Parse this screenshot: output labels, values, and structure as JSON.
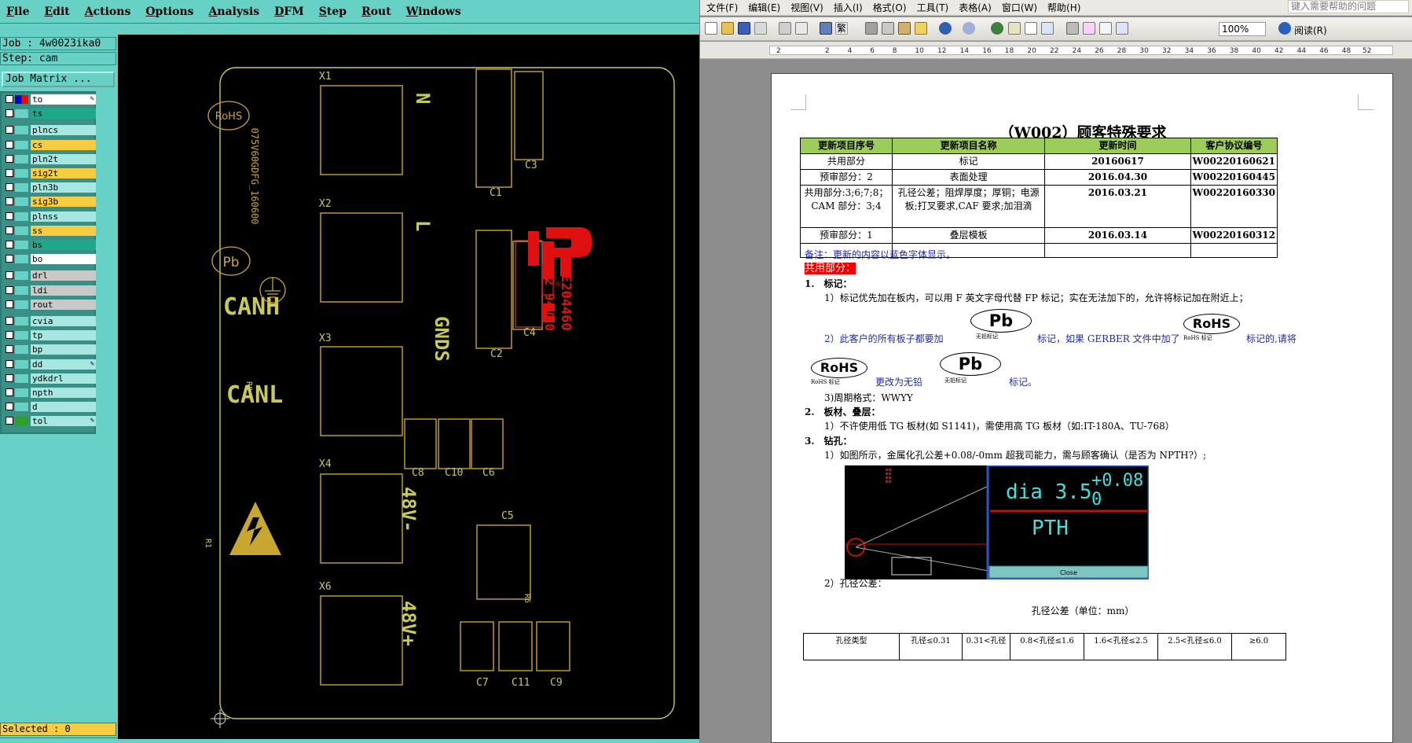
{
  "cam": {
    "menu": [
      "File",
      "Edit",
      "Actions",
      "Options",
      "Analysis",
      "DFM",
      "Step",
      "Rout",
      "Windows"
    ],
    "job_label": "Job : 4w0023ika0",
    "step_label": "Step: cam",
    "job_matrix_button": "Job Matrix ...",
    "layers": [
      {
        "name": "to",
        "style": "white",
        "swatch": "#0000cc",
        "swatch2": "#ff0000",
        "icon": "pencil"
      },
      {
        "name": "ts",
        "style": "green"
      },
      {
        "name": "plncs",
        "style": "cyan"
      },
      {
        "name": "cs",
        "style": "yellow"
      },
      {
        "name": "pln2t",
        "style": "cyan"
      },
      {
        "name": "sig2t",
        "style": "yellow"
      },
      {
        "name": "pln3b",
        "style": "cyan"
      },
      {
        "name": "sig3b",
        "style": "yellow"
      },
      {
        "name": "plnss",
        "style": "cyan"
      },
      {
        "name": "ss",
        "style": "yellow"
      },
      {
        "name": "bs",
        "style": "green"
      },
      {
        "name": "bo",
        "style": "white"
      },
      {
        "name": "drl",
        "style": "gray"
      },
      {
        "name": "ldi",
        "style": "gray"
      },
      {
        "name": "rout",
        "style": "gray"
      },
      {
        "name": "cvia",
        "style": "cyan"
      },
      {
        "name": "tp",
        "style": "cyan"
      },
      {
        "name": "bp",
        "style": "cyan"
      },
      {
        "name": "dd",
        "style": "cyan",
        "icon": "pencil"
      },
      {
        "name": "ydkdrl",
        "style": "cyan"
      },
      {
        "name": "npth",
        "style": "cyan"
      },
      {
        "name": "d",
        "style": "cyan"
      },
      {
        "name": "tol",
        "style": "cyan",
        "swatch": "#2ea02e",
        "icon": "pencil"
      }
    ],
    "selected_label": "Selected : 0",
    "board": {
      "silkscreen": {
        "rohs": "RoHS",
        "pb": "Pb",
        "date_code": "075V60GDFG_160600",
        "n": "N",
        "l": "L",
        "canh": "CANH",
        "canl": "CANL",
        "gnds": "GNDS",
        "v48n": "48V-",
        "v48p": "48V+",
        "ul_line1": "E204460",
        "ul_line2": "M2 94V-0",
        "refs": [
          "X1",
          "X2",
          "X3",
          "X4",
          "X6",
          "C1",
          "C2",
          "C3",
          "C4",
          "C5",
          "C6",
          "C7",
          "C8",
          "C10",
          "C11",
          "C9",
          "R8",
          "R1",
          "R5",
          "R6"
        ]
      }
    }
  },
  "word": {
    "menu": [
      "文件(F)",
      "编辑(E)",
      "视图(V)",
      "插入(I)",
      "格式(O)",
      "工具(T)",
      "表格(A)",
      "窗口(W)",
      "帮助(H)"
    ],
    "help_placeholder": "键入需要帮助的问题",
    "zoom": "100%",
    "reading_button": "阅读(R)",
    "ruler_numbers": [
      "2",
      "2",
      "4",
      "6",
      "8",
      "10",
      "12",
      "14",
      "16",
      "18",
      "20",
      "22",
      "24",
      "26",
      "28",
      "30",
      "32",
      "34",
      "36",
      "38",
      "40",
      "42",
      "44",
      "46",
      "48",
      "52"
    ],
    "doc": {
      "title": "（W002）顾客特殊要求",
      "update_table": {
        "headers": [
          "更新项目序号",
          "更新项目名称",
          "更新时间",
          "客户协议编号"
        ],
        "rows": [
          [
            "共用部分",
            "标记",
            "20160617",
            "W00220160621"
          ],
          [
            "预审部分：2",
            "表面处理",
            "2016.04.30",
            "W00220160445"
          ],
          [
            "共用部分:3;6;7;8；CAM 部分：3;4",
            "孔径公差；阻焊厚度；厚铜；电源板;打叉要求,CAF 要求;加泪滴",
            "2016.03.21",
            "W00220160330"
          ],
          [
            "预审部分：1",
            "叠层模板",
            "2016.03.14",
            "W00220160312"
          ],
          [
            "",
            "",
            "",
            ""
          ]
        ]
      },
      "note": "备注：更新的内容以蓝色字体显示。",
      "shared_heading": "共用部分：",
      "s1_heading": "1.　标记：",
      "s1_item1": "1）标记优先加在板内，可以用 F 英文字母代替 FP 标记；实在无法加下的，允许将标记加在附近上；",
      "s1_item2a": "2）此客户的所有板子都要加",
      "s1_item2b": "标记，如果 GERBER 文件中加了",
      "s1_item2c": "标记的,请将",
      "s1_item2d": "更改为无铅",
      "s1_item2e": "标记。",
      "logo_pb": "Pb",
      "logo_rohs": "RoHS",
      "logo_pb_caption": "无铅标记",
      "logo_rohs_caption": "RoHS 标记",
      "s1_item3": "3)周期格式：WWYY",
      "s2_heading": "2.　板材、叠层：",
      "s2_item1": "1）不许使用低 TG 板材(如 S1141)，需使用高 TG 板材（如:IT-180A、TU-768）",
      "s3_heading": "3.　钻孔：",
      "s3_item1": "1）如图所示，金属化孔公差+0.08/-0mm 超我司能力，需与顾客确认（是否为 NPTH?）;",
      "drill_img": {
        "dia": "dia 3.5",
        "tol_plus": "+0.08",
        "tol_minus": "0",
        "pth": "PTH",
        "close": "Close"
      },
      "s3_item2": "2）孔径公差：",
      "tol_caption": "孔径公差（单位：mm）",
      "tol_table": [
        "孔径类型",
        "孔径≤0.31",
        "0.31<孔径",
        "0.8<孔径≤1.6",
        "1.6<孔径≤2.5",
        "2.5<孔径≤6.0",
        "≥6.0"
      ]
    }
  }
}
